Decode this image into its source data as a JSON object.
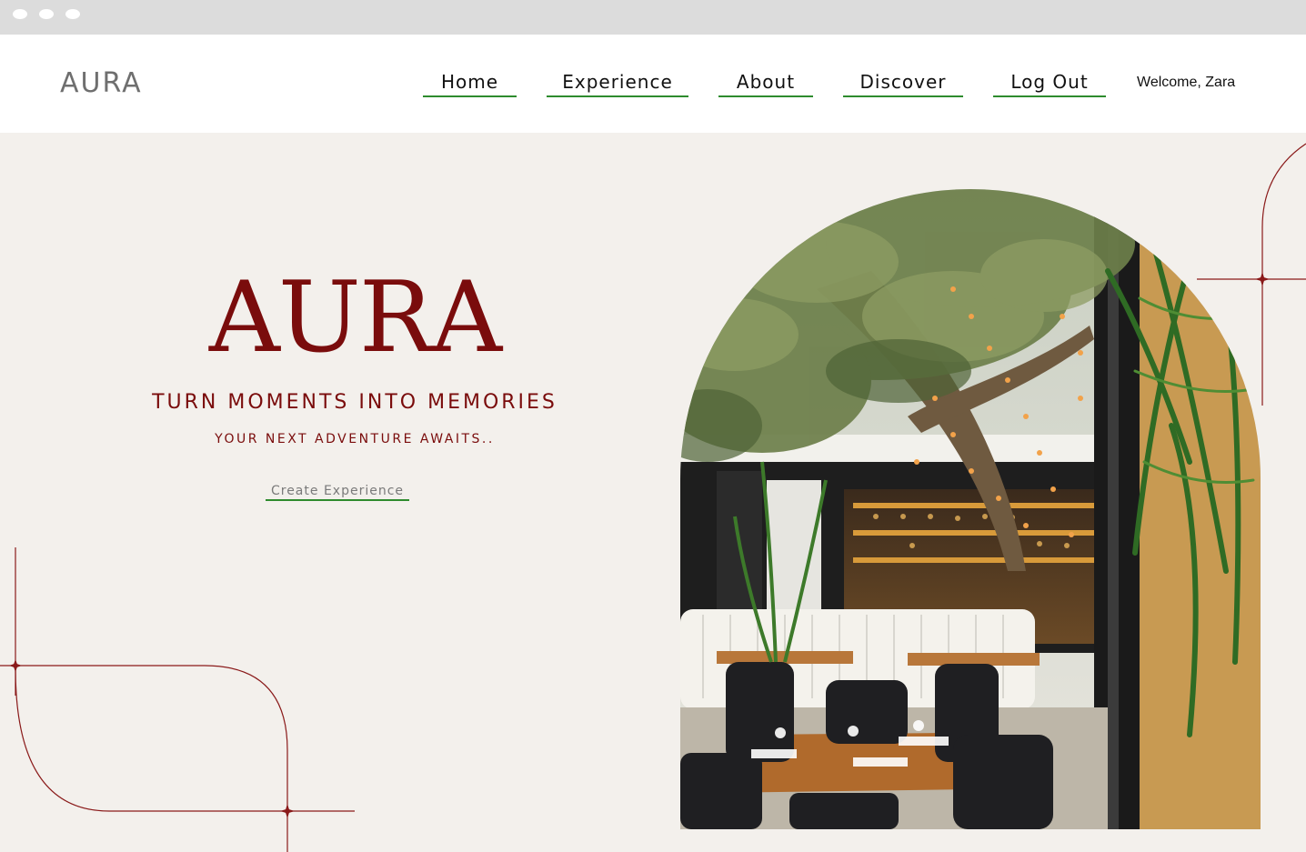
{
  "browser": {
    "dots": 3
  },
  "header": {
    "logo": "AURA",
    "nav": [
      {
        "label": "Home"
      },
      {
        "label": "Experience"
      },
      {
        "label": "About"
      },
      {
        "label": "Discover"
      },
      {
        "label": "Log Out"
      }
    ],
    "welcome": "Welcome, Zara"
  },
  "hero": {
    "title": "AURA",
    "tagline": "TURN MOMENTS INTO MEMORIES",
    "subtagline": "YOUR NEXT ADVENTURE AWAITS..",
    "cta_label": "Create Experience"
  },
  "image": {
    "subject": "restaurant-patio-photo"
  },
  "colors": {
    "accent": "#7a0c0c",
    "underline": "#2e8b2e",
    "background": "#f3f0ec"
  }
}
